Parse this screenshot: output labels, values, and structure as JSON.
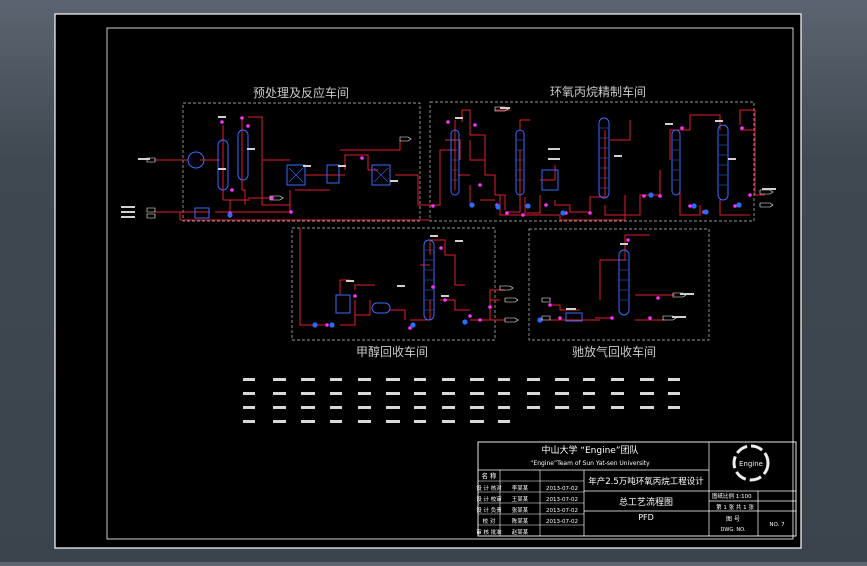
{
  "sections": {
    "pretreatment": "预处理及反应车间",
    "purification": "环氧丙烷精制车间",
    "methanol": "甲醇回收车间",
    "tailgas": "驰放气回收车间"
  },
  "title_block": {
    "team_cn": "中山大学 “Engine”团队",
    "team_en": "“Engine”Team of Sun Yat-sen University",
    "project": "年产2.5万吨环氧丙烷工程设计",
    "drawing_title": "总工艺流程图",
    "drawing_code": "PFD",
    "logo_text": "Engine",
    "role_header": "名 称",
    "roles": [
      {
        "label": "设 计 核对",
        "name": "李某某",
        "date": "2013-07-02"
      },
      {
        "label": "设 计 校审",
        "name": "王某某",
        "date": "2013-07-02"
      },
      {
        "label": "设 计 负责",
        "name": "张某某",
        "date": "2013-07-02"
      },
      {
        "label": "校 对",
        "name": "陈某某",
        "date": "2013-07-02"
      },
      {
        "label": "审 核 批准",
        "name": "赵某某",
        "date": ""
      }
    ],
    "scale": "图纸比例 1:100",
    "sheet": "第 1 张 共 1 张",
    "graph_label": "图 号",
    "dwg_no_label": "DWG. NO.",
    "no_label": "NO. 7"
  },
  "colors": {
    "frame": "#ffffff",
    "stream": "#e0202c",
    "equipment": "#3a6cff",
    "node": "#ff33ff",
    "dashed": "#c8c8c8",
    "heading": "#c9c9c9"
  }
}
